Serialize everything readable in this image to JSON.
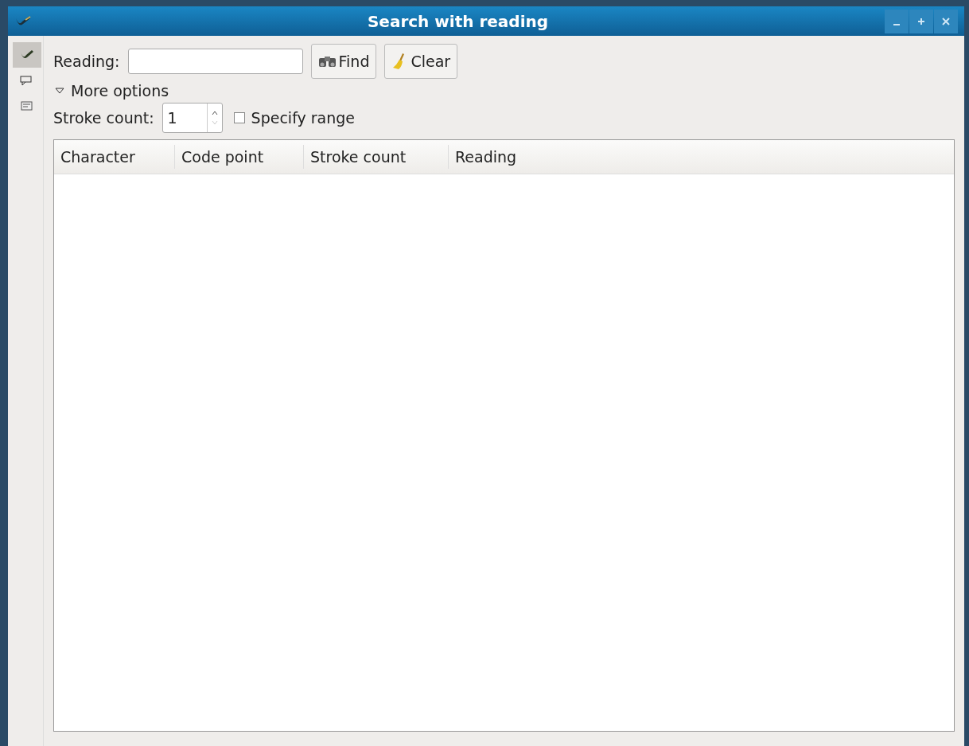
{
  "window": {
    "title": "Search with reading"
  },
  "side_tabs": [
    {
      "selected": true
    },
    {
      "selected": false
    },
    {
      "selected": false
    }
  ],
  "reading": {
    "label": "Reading:"
  },
  "buttons": [
    {
      "kind": "find",
      "label": "Find"
    },
    {
      "kind": "clear",
      "label": "Clear"
    }
  ],
  "more_options": {
    "label": "More options",
    "expanded": true
  },
  "stroke_count": {
    "label": "Stroke count:",
    "value": "1"
  },
  "specify_range": {
    "label": "Specify range",
    "checked": false
  },
  "table": {
    "columns": [
      "Character",
      "Code point",
      "Stroke count",
      "Reading"
    ]
  }
}
